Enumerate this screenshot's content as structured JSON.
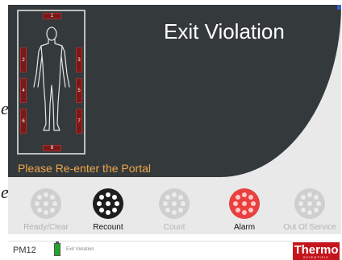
{
  "screen": {
    "title": "Exit Violation",
    "status_message": "Please Re-enter the Portal"
  },
  "portal": {
    "sensors": [
      {
        "id": "1",
        "active": true
      },
      {
        "id": "2",
        "active": true
      },
      {
        "id": "3",
        "active": true
      },
      {
        "id": "4",
        "active": true
      },
      {
        "id": "5",
        "active": true
      },
      {
        "id": "6",
        "active": true
      },
      {
        "id": "7",
        "active": true
      },
      {
        "id": "8",
        "active": true
      }
    ]
  },
  "buttons": [
    {
      "label": "Ready/Clear",
      "state": "disabled",
      "icon": "dial-icon"
    },
    {
      "label": "Recount",
      "state": "enabled",
      "icon": "dial-icon"
    },
    {
      "label": "Count",
      "state": "disabled",
      "icon": "dial-icon"
    },
    {
      "label": "Alarm",
      "state": "alarm",
      "icon": "dial-icon"
    },
    {
      "label": "Out Of Service",
      "state": "disabled",
      "icon": "dial-icon"
    }
  ],
  "status_bar": {
    "device_id": "PM12",
    "status_text": "Exit Violation",
    "battery_icon": "battery-icon",
    "brand_name": "Thermo",
    "brand_sub": "SCIENTIFIC"
  },
  "page_glyphs": [
    "e",
    "e"
  ],
  "colors": {
    "panel": "#34393b",
    "screen_bg": "#e9e9e9",
    "title": "#ffffff",
    "status_message": "#f0a64a",
    "sensor": "#7a1919",
    "alarm": "#e8413f",
    "enabled": "#1e1e1e",
    "disabled": "#cfcfcf",
    "battery": "#1ea82a",
    "brand": "#c4161c"
  }
}
